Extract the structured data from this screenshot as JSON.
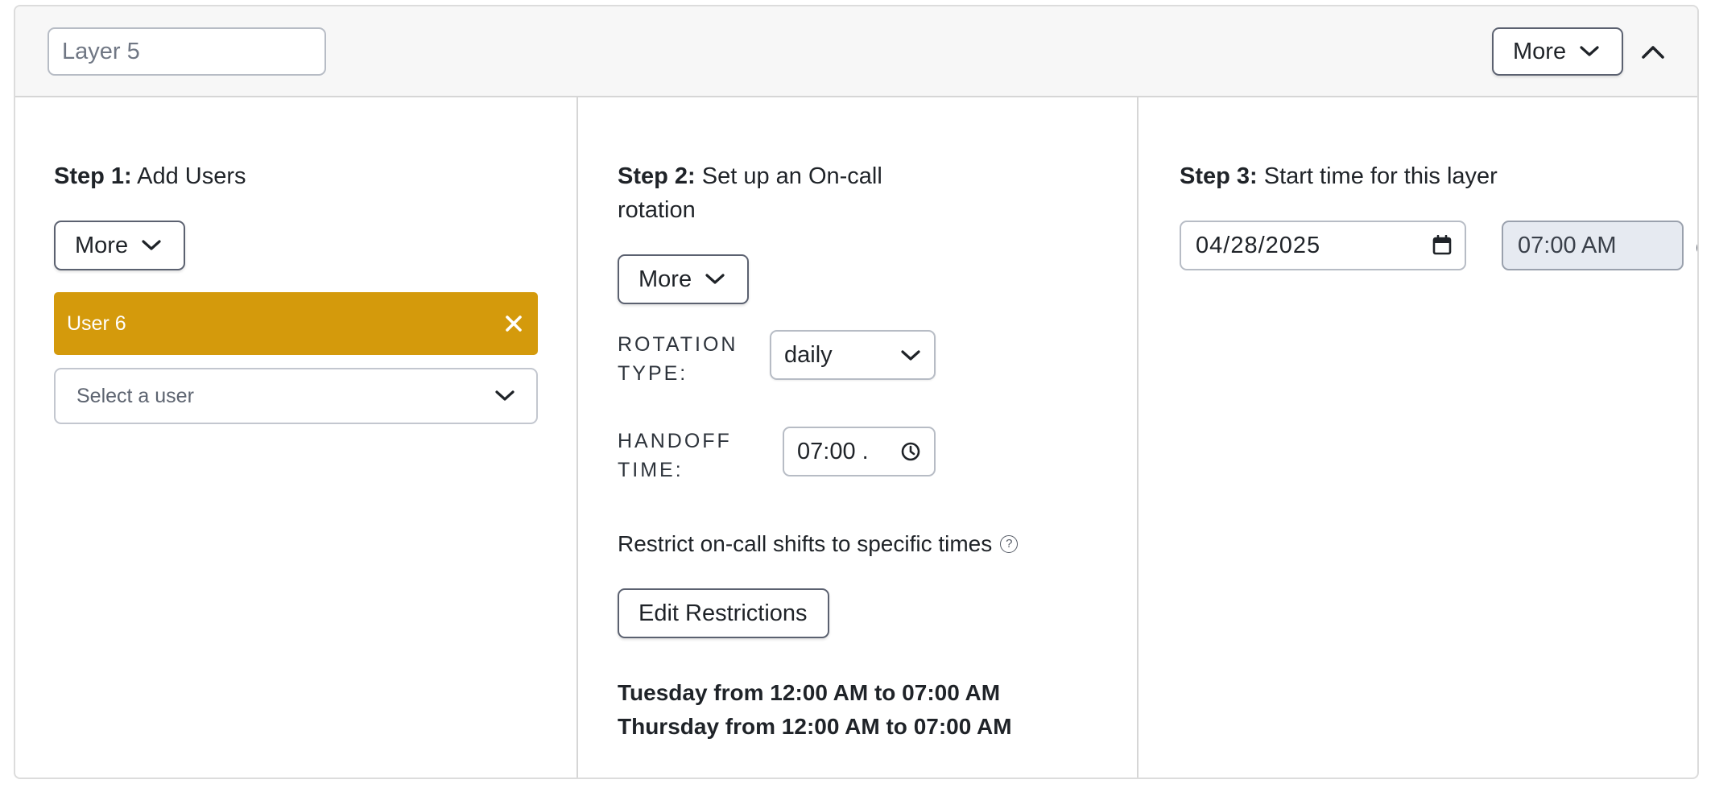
{
  "header": {
    "layer_name_value": "",
    "layer_name_placeholder": "Layer 5",
    "more_label": "More"
  },
  "step1": {
    "title_bold": "Step 1:",
    "title_rest": " Add Users",
    "more_label": "More",
    "users": [
      {
        "name": "User 6",
        "color": "#d49a0c"
      }
    ],
    "select_placeholder": "Select a user"
  },
  "step2": {
    "title_bold": "Step 2:",
    "title_rest_line1": " Set up an On-call",
    "title_rest_line2": "rotation",
    "more_label": "More",
    "rotation_type_label_line1": "ROTATION",
    "rotation_type_label_line2": "TYPE:",
    "rotation_type_value": "daily",
    "handoff_label_line1": "HANDOFF",
    "handoff_label_line2": "TIME:",
    "handoff_value": "07:00 .",
    "restrict_label": "Restrict on-call shifts to specific times",
    "edit_restrictions_label": "Edit Restrictions",
    "restrictions": [
      "Tuesday from 12:00 AM to 07:00 AM",
      "Thursday from 12:00 AM to 07:00 AM"
    ]
  },
  "step3": {
    "title_bold": "Step 3:",
    "title_rest": " Start time for this layer",
    "start_date": "04/28/2025",
    "start_time": "07:00 AM"
  },
  "icons": {
    "chevron": "chevron-down-icon",
    "collapse": "chevron-up-icon",
    "close": "close-icon",
    "calendar": "calendar-icon",
    "clock": "clock-icon",
    "help": "help-icon"
  },
  "colors": {
    "user_chip": "#d49a0c",
    "start_time_bg": "#e6eaf1"
  }
}
